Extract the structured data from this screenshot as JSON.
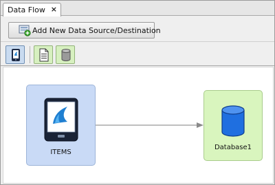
{
  "tab": {
    "title": "Data Flow",
    "close": "×"
  },
  "toolbar": {
    "add_label": "Add New Data Source/Destination"
  },
  "nodes": [
    {
      "label": "ITEMS",
      "icon": "mobile-entity-icon"
    },
    {
      "label": "Database1",
      "icon": "database-icon"
    }
  ],
  "colors": {
    "entity_node": "#c9daf6",
    "database_node": "#d9f5be",
    "database_icon": "#1f6fe0",
    "connector": "#7f7f7f"
  }
}
